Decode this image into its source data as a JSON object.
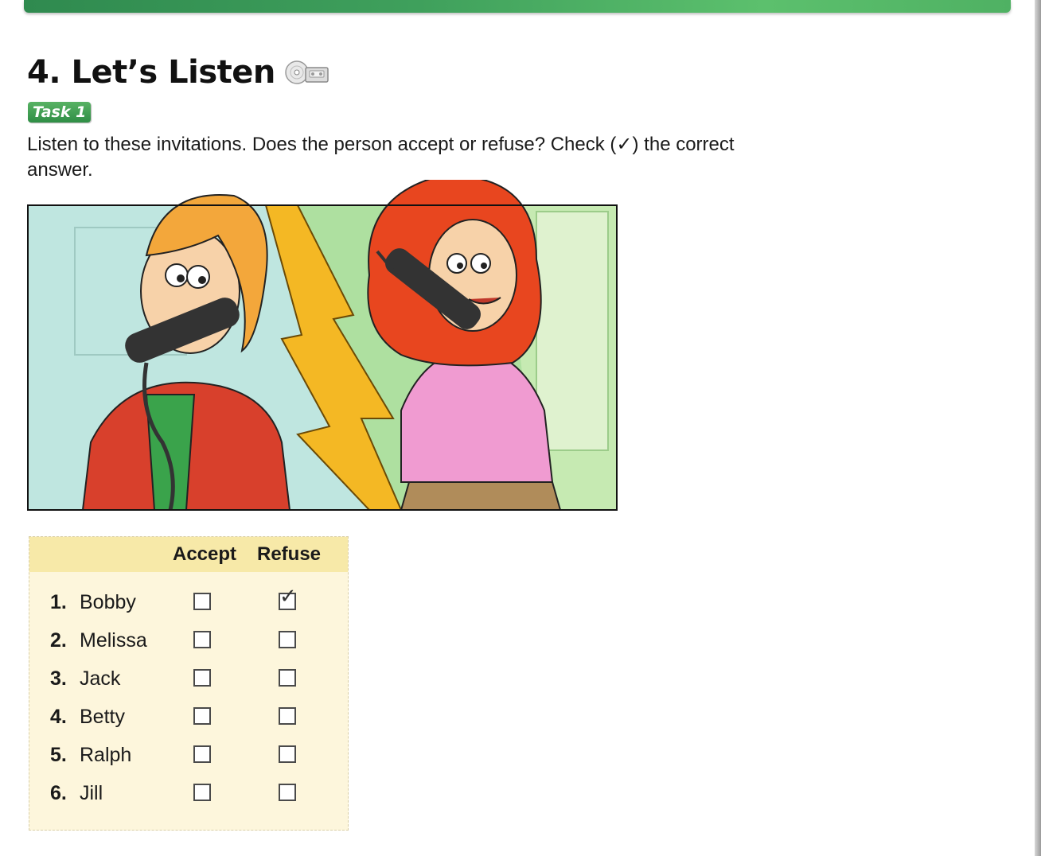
{
  "heading": {
    "title": "4. Let’s Listen",
    "icon": "cd-audio-icon"
  },
  "task": {
    "label": "Task 1"
  },
  "instructions": "Listen to these invitations. Does the person accept or refuse? Check (✓) the correct answer.",
  "illustration": {
    "icon": "phone-call-illustration"
  },
  "table": {
    "headers": {
      "accept": "Accept",
      "refuse": "Refuse"
    },
    "rows": [
      {
        "num": "1.",
        "name": "Bobby",
        "accept": false,
        "refuse": true
      },
      {
        "num": "2.",
        "name": "Melissa",
        "accept": false,
        "refuse": false
      },
      {
        "num": "3.",
        "name": "Jack",
        "accept": false,
        "refuse": false
      },
      {
        "num": "4.",
        "name": "Betty",
        "accept": false,
        "refuse": false
      },
      {
        "num": "5.",
        "name": "Ralph",
        "accept": false,
        "refuse": false
      },
      {
        "num": "6.",
        "name": "Jill",
        "accept": false,
        "refuse": false
      }
    ],
    "check_glyph": "✓"
  },
  "colors": {
    "band_green": "#3fa05c",
    "badge_green": "#2f8e45",
    "table_bg": "#fdf6dc",
    "table_header_bg": "#f7e9a8"
  }
}
